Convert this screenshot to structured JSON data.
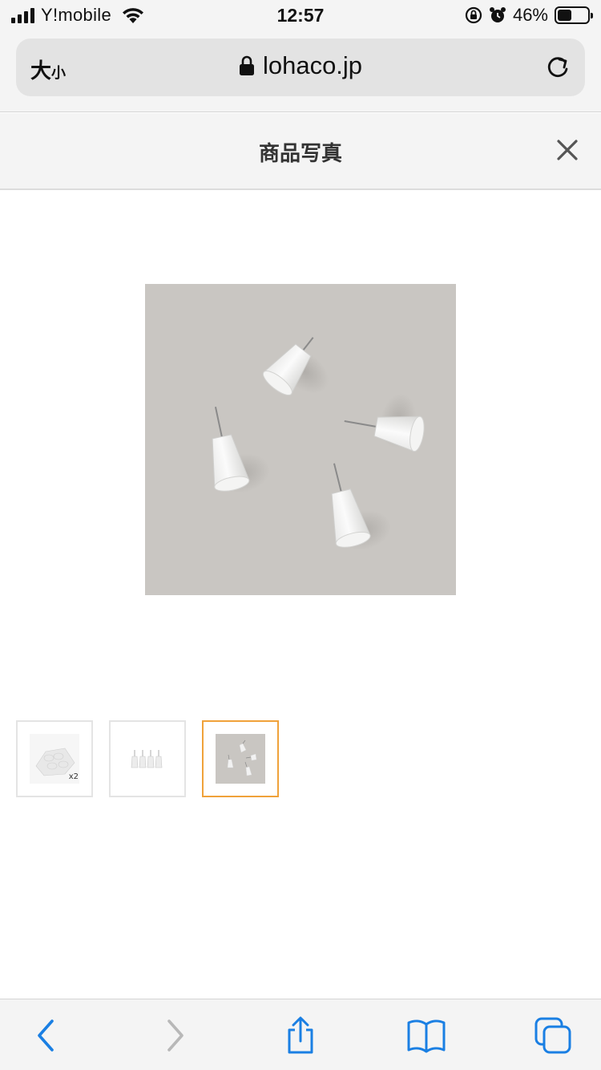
{
  "status_bar": {
    "carrier": "Y!mobile",
    "time": "12:57",
    "battery_percent": "46%",
    "battery_level": 0.46,
    "signal_bars": 4
  },
  "browser": {
    "text_size_label": "大",
    "text_size_label_small": "小",
    "url": "lohaco.jp"
  },
  "modal": {
    "title": "商品写真",
    "close_icon": "close-icon"
  },
  "gallery": {
    "selected_index": 2,
    "thumbnails": [
      {
        "name": "thumbnail-1",
        "badge": "x2"
      },
      {
        "name": "thumbnail-2",
        "badge": ""
      },
      {
        "name": "thumbnail-3",
        "badge": ""
      }
    ]
  },
  "toolbar": {
    "icons": [
      "back-icon",
      "forward-icon",
      "share-icon",
      "bookmarks-icon",
      "tabs-icon"
    ]
  },
  "colors": {
    "accent": "#1a7fe3",
    "selected_border": "#f0a23a",
    "photo_bg": "#c9c6c2"
  }
}
